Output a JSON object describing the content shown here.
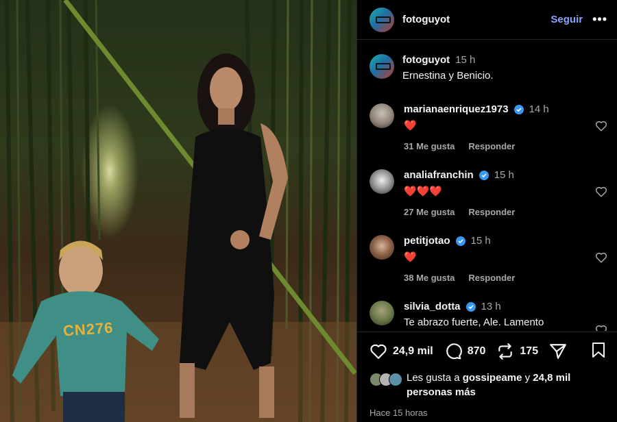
{
  "post": {
    "username": "fotoguyot",
    "follow_label": "Seguir",
    "more_label": "•••",
    "caption_username": "fotoguyot",
    "caption_time": "15 h",
    "caption_text": "Ernestina y Benicio."
  },
  "comments": [
    {
      "username": "marianaenriquez1973",
      "time": "14 h",
      "text": "❤️",
      "likes": "31 Me gusta",
      "reply": "Responder",
      "verified": true
    },
    {
      "username": "analiafranchin",
      "time": "15 h",
      "text": "❤️❤️❤️",
      "likes": "27 Me gusta",
      "reply": "Responder",
      "verified": true
    },
    {
      "username": "petitjotao",
      "time": "15 h",
      "text": "❤️",
      "likes": "38 Me gusta",
      "reply": "Responder",
      "verified": true
    },
    {
      "username": "silvia_dotta",
      "time": "13 h",
      "text": "Te abrazo fuerte, Ale. Lamento",
      "verified": true
    }
  ],
  "actions": {
    "likes_count": "24,9 mil",
    "comments_count": "870",
    "reposts_count": "175"
  },
  "liked_by": {
    "prefix": "Les gusta a",
    "user": "gossipeame",
    "connector": "y",
    "others": "24,8 mil personas más"
  },
  "time_ago": "Hace 15 horas",
  "photo": {
    "shirt_text": "CN276"
  },
  "colors": {
    "accent_link": "#8aa3ff",
    "verified": "#3897f0",
    "heart": "#ed2f3c"
  }
}
